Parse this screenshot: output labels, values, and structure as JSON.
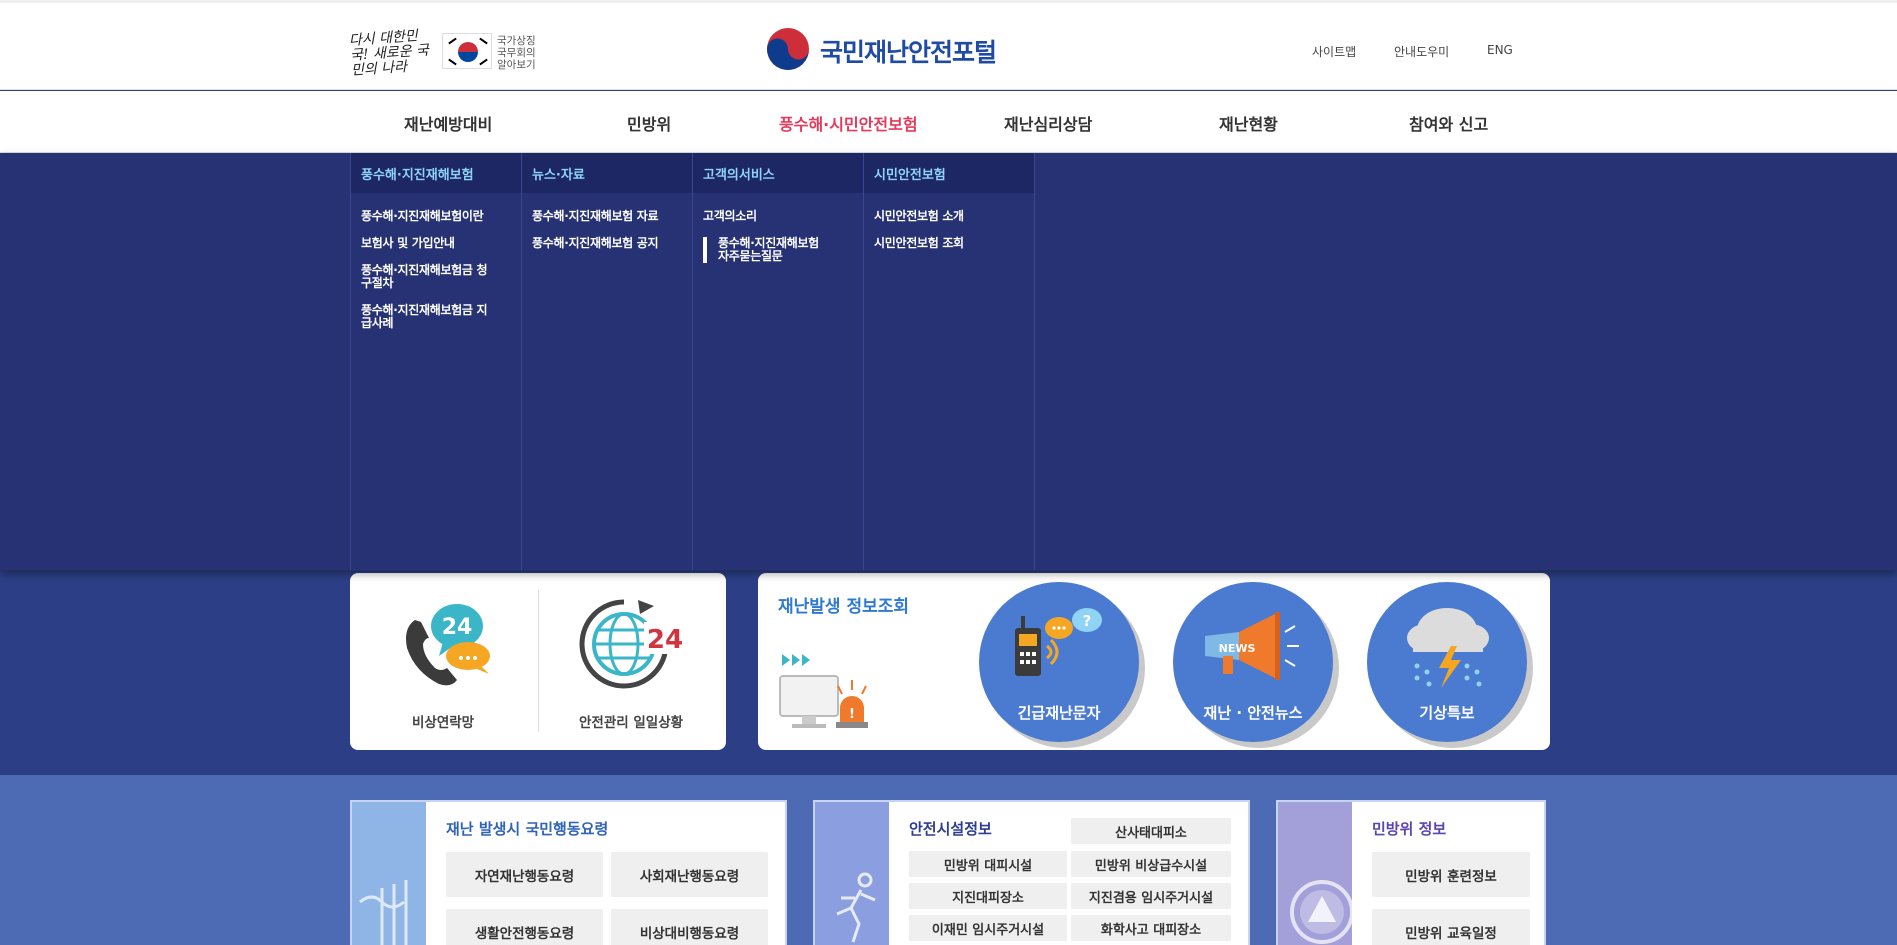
{
  "header": {
    "slogan": "다시 대한민국! 새로운 국민의 나라",
    "bars_link": "국가상징 국무회의 알아보기",
    "logo_text": "국민재난안전포털",
    "util": [
      "사이트맵",
      "안내도우미",
      "ENG"
    ]
  },
  "gnb": [
    "재난예방대비",
    "민방위",
    "풍수해·시민안전보험",
    "재난심리상담",
    "재난현황",
    "참여와 신고"
  ],
  "gnb_active": "풍수해·시민안전보험",
  "mega": [
    {
      "title": "풍수해·지진재해보험",
      "items": [
        "풍수해·지진재해보험이란",
        "보험사 및 가입안내",
        "풍수해·지진재해보험금 청구절차",
        "풍수해·지진재해보험금 지급사례"
      ]
    },
    {
      "title": "뉴스·자료",
      "items": [
        "풍수해·지진재해보험 자료",
        "풍수해·지진재해보험 공지"
      ]
    },
    {
      "title": "고객의서비스",
      "items": [
        "고객의소리",
        "풍수해·지진재해보험 자주묻는질문"
      ]
    },
    {
      "title": "시민안전보험",
      "items": [
        "시민안전보험 소개",
        "시민안전보험 조회"
      ]
    }
  ],
  "quick_links": {
    "emergency_network": "비상연락망",
    "daily_status": "안전관리 일일상황",
    "badge_24": "24"
  },
  "disaster_info": {
    "title": "재난발생 정보조회",
    "circles": [
      "긴급재난문자",
      "재난 · 안전뉴스",
      "기상특보"
    ],
    "news_badge": "NEWS",
    "question_mark": "?"
  },
  "bottom": {
    "conduct": {
      "title": "재난 발생시 국민행동요령",
      "items": [
        "자연재난행동요령",
        "사회재난행동요령",
        "생활안전행동요령",
        "비상대비행동요령"
      ]
    },
    "facility": {
      "title": "안전시설정보",
      "items": [
        "산사태대피소",
        "민방위 대피시설",
        "민방위 비상급수시설",
        "지진대피장소",
        "지진겸용 임시주거시설",
        "이재민 임시주거시설",
        "화학사고 대피장소"
      ]
    },
    "civil": {
      "title": "민방위 정보",
      "items": [
        "민방위 훈련정보",
        "민방위 교육일정"
      ]
    }
  },
  "colors": {
    "accent": "#e43a5b",
    "navy": "#263273",
    "blue": "#4a7bd0",
    "sky": "#8fd3f5"
  }
}
